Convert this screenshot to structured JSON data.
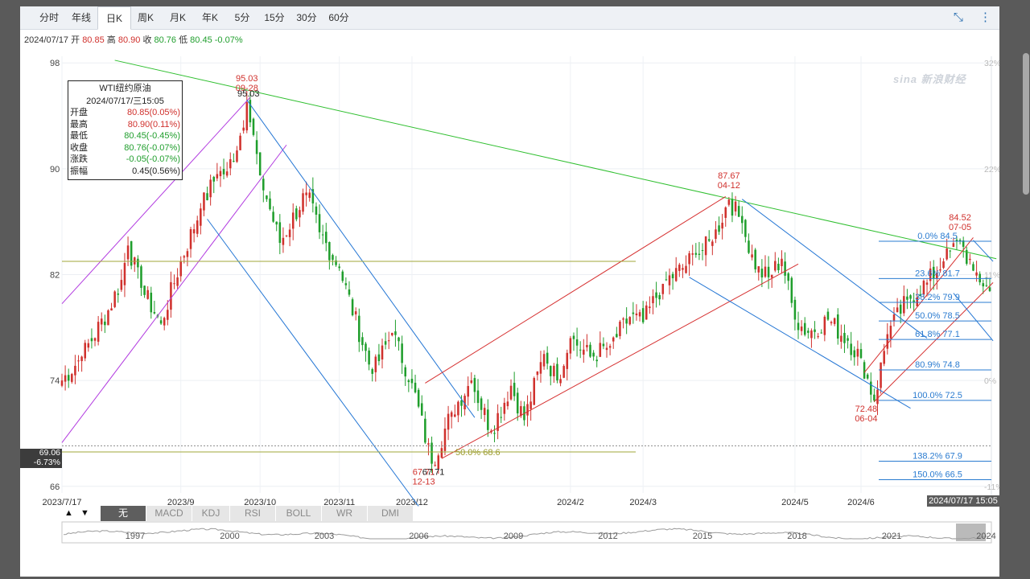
{
  "tabs": [
    {
      "label": "分时",
      "active": false
    },
    {
      "label": "年线",
      "active": false
    },
    {
      "label": "日K",
      "active": true
    },
    {
      "label": "周K",
      "active": false
    },
    {
      "label": "月K",
      "active": false
    },
    {
      "label": "年K",
      "active": false
    },
    {
      "label": "5分",
      "active": false
    },
    {
      "label": "15分",
      "active": false
    },
    {
      "label": "30分",
      "active": false
    },
    {
      "label": "60分",
      "active": false
    }
  ],
  "tools": {
    "fullscreen_icon": "⤡",
    "menu_icon": "⋮"
  },
  "ohlc": {
    "date": "2024/07/17",
    "open_label": "开",
    "open": "80.85",
    "high_label": "高",
    "high": "80.90",
    "close_label": "收",
    "close": "80.76",
    "low_label": "低",
    "low": "80.45",
    "change": "-0.07%"
  },
  "infobox": {
    "title": "WTI纽约原油",
    "datetime": "2024/07/17/三15:05",
    "rows": [
      {
        "k": "开盘",
        "v": "80.85(0.05%)",
        "color": "red"
      },
      {
        "k": "最高",
        "v": "80.90(0.11%)",
        "color": "red"
      },
      {
        "k": "最低",
        "v": "80.45(-0.45%)",
        "color": "green"
      },
      {
        "k": "收盘",
        "v": "80.76(-0.07%)",
        "color": "green"
      },
      {
        "k": "涨跌",
        "v": "-0.05(-0.07%)",
        "color": "green"
      },
      {
        "k": "振幅",
        "v": "0.45(0.56%)",
        "color": "black"
      }
    ]
  },
  "price_marker": {
    "price": "69.06",
    "pct": "-6.73%"
  },
  "date_marker": "2024/07/17 15:05",
  "indicators": [
    {
      "label": "无",
      "active": true
    },
    {
      "label": "MACD",
      "active": false
    },
    {
      "label": "KDJ",
      "active": false
    },
    {
      "label": "RSI",
      "active": false
    },
    {
      "label": "BOLL",
      "active": false
    },
    {
      "label": "WR",
      "active": false
    },
    {
      "label": "DMI",
      "active": false
    }
  ],
  "arrows": {
    "up": "▲",
    "down": "▼"
  },
  "watermark": "sina 新浪财经",
  "colors": {
    "up": "#d0312d",
    "down": "#1f9e2c",
    "channel_purple": "#b23be0",
    "channel_blue": "#2476d4",
    "channel_red": "#d63131",
    "trend_green": "#2fbf2f",
    "fib_blue": "#2a7bd0",
    "level_olive": "#a0a73a"
  },
  "chart_data": {
    "type": "candlestick",
    "y_ticks": [
      98,
      90,
      82,
      74,
      66
    ],
    "ylim": [
      65.5,
      98.5
    ],
    "pct_ticks": [
      "32%",
      "22%",
      "11%",
      "0%",
      "-11%"
    ],
    "x_ticks": [
      "2023/7/17",
      "2023/9",
      "2023/10",
      "2023/11",
      "2023/12",
      "2024/2",
      "2024/3",
      "2024/5",
      "2024/6"
    ],
    "x_tick_index": [
      0,
      36,
      60,
      84,
      106,
      154,
      176,
      222,
      242
    ],
    "n_bars": 282,
    "waypoints": [
      [
        0,
        74.0
      ],
      [
        6,
        75.8
      ],
      [
        14,
        79.3
      ],
      [
        18,
        81.6
      ],
      [
        20,
        84.2
      ],
      [
        24,
        81.0
      ],
      [
        30,
        78.3
      ],
      [
        36,
        83.0
      ],
      [
        42,
        87.0
      ],
      [
        47,
        89.6
      ],
      [
        50,
        89.8
      ],
      [
        54,
        92.5
      ],
      [
        56,
        95.03
      ],
      [
        60,
        89.5
      ],
      [
        66,
        84.4
      ],
      [
        74,
        88.2
      ],
      [
        78,
        85.2
      ],
      [
        84,
        82.5
      ],
      [
        94,
        74.5
      ],
      [
        100,
        77.6
      ],
      [
        106,
        73.8
      ],
      [
        112,
        67.71
      ],
      [
        118,
        71.6
      ],
      [
        124,
        74.0
      ],
      [
        130,
        70.2
      ],
      [
        136,
        73.6
      ],
      [
        140,
        71.0
      ],
      [
        146,
        76.0
      ],
      [
        150,
        74.0
      ],
      [
        154,
        77.2
      ],
      [
        160,
        75.8
      ],
      [
        166,
        76.6
      ],
      [
        172,
        78.8
      ],
      [
        176,
        78.4
      ],
      [
        182,
        81.3
      ],
      [
        188,
        82.5
      ],
      [
        192,
        83.5
      ],
      [
        197,
        84.5
      ],
      [
        202,
        87.67
      ],
      [
        206,
        85.9
      ],
      [
        210,
        82.4
      ],
      [
        214,
        81.8
      ],
      [
        218,
        83.2
      ],
      [
        222,
        78.6
      ],
      [
        226,
        77.6
      ],
      [
        232,
        78.6
      ],
      [
        238,
        77.0
      ],
      [
        242,
        75.7
      ],
      [
        246,
        72.48
      ],
      [
        250,
        77.5
      ],
      [
        256,
        80.1
      ],
      [
        262,
        81.4
      ],
      [
        267,
        83.0
      ],
      [
        272,
        84.52
      ],
      [
        276,
        82.3
      ],
      [
        281,
        80.76
      ]
    ],
    "annotations": [
      {
        "text": "95.03",
        "sub": "09-28",
        "index": 56,
        "price": 95.03,
        "color": "red",
        "side": "top"
      },
      {
        "text": "95.03",
        "index": 56,
        "price": 95.03,
        "color": "black",
        "side": "near"
      },
      {
        "text": "67.71",
        "sub": "12-13",
        "index": 112,
        "price": 67.71,
        "color": "red",
        "side": "bottom"
      },
      {
        "text": "67.71",
        "index": 112,
        "price": 67.71,
        "color": "black",
        "side": "near"
      },
      {
        "text": "87.67",
        "sub": "04-12",
        "index": 202,
        "price": 87.67,
        "color": "red",
        "side": "top"
      },
      {
        "text": "72.48",
        "sub": "06-04",
        "index": 246,
        "price": 72.48,
        "color": "red",
        "side": "bottom"
      },
      {
        "text": "84.52",
        "sub": "07-05",
        "index": 272,
        "price": 84.52,
        "color": "red",
        "side": "top"
      }
    ],
    "fib_levels": [
      {
        "label": "0.0% 84.5",
        "price": 84.52
      },
      {
        "label": "23.6% 81.7",
        "price": 81.7
      },
      {
        "label": "38.2% 79.9",
        "price": 79.9
      },
      {
        "label": "50.0% 78.5",
        "price": 78.5
      },
      {
        "label": "61.8% 77.1",
        "price": 77.1
      },
      {
        "label": "80.9% 74.8",
        "price": 74.8
      },
      {
        "label": "100.0% 72.5",
        "price": 72.5
      },
      {
        "label": "138.2% 67.9",
        "price": 67.9
      },
      {
        "label": "150.0% 66.5",
        "price": 66.5
      }
    ],
    "olive_levels": [
      {
        "label": "",
        "price": 83.0
      },
      {
        "label": "50.0% 68.6",
        "price": 68.6
      }
    ],
    "dashed_level": 69.06,
    "overview": {
      "labels": [
        "1997",
        "2000",
        "2003",
        "2006",
        "2009",
        "2012",
        "2015",
        "2018",
        "2021",
        "2024"
      ]
    }
  }
}
